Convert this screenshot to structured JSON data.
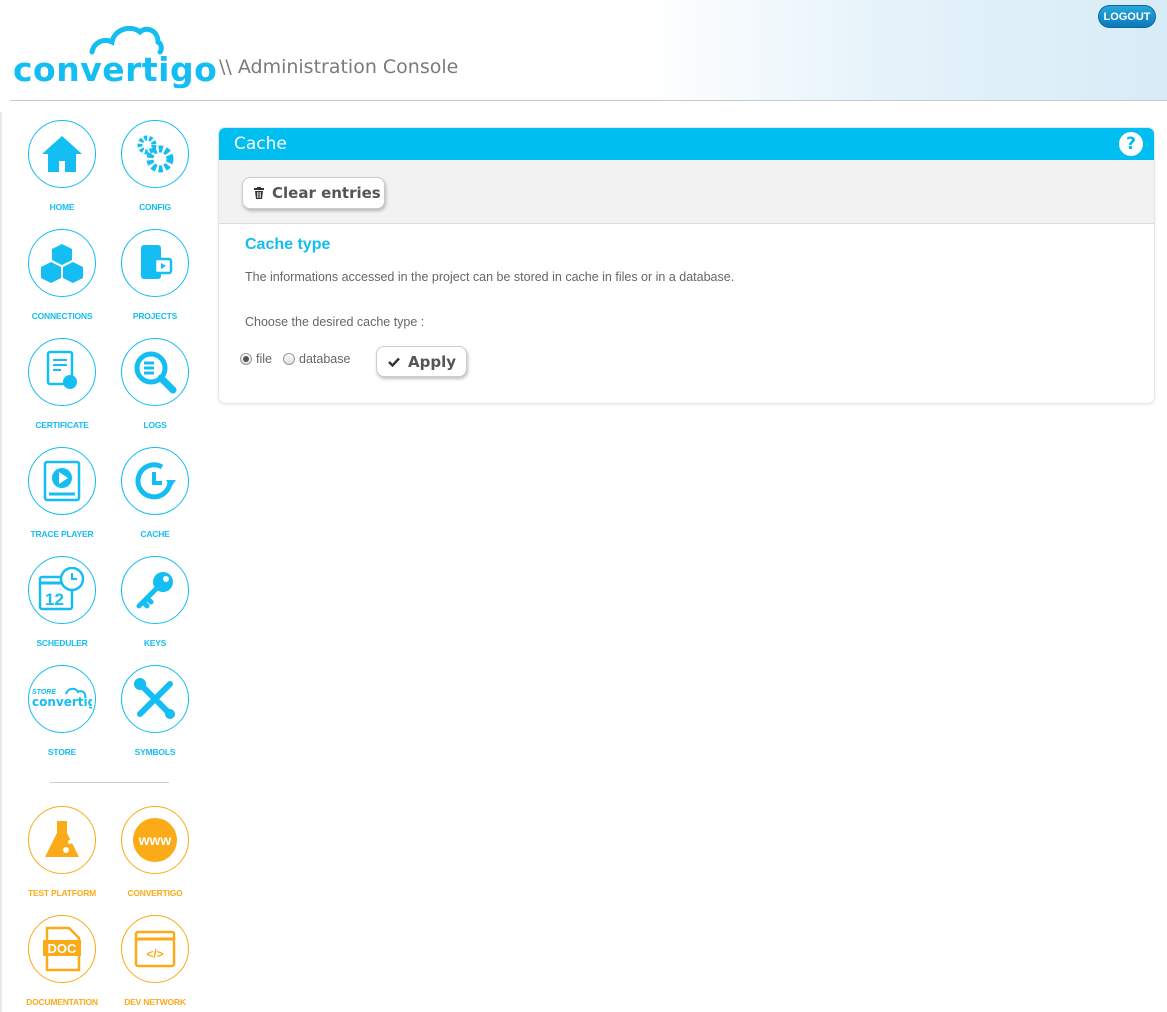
{
  "header": {
    "logo_text": "convertigo",
    "title": "\\\\ Administration Console",
    "logout": "LOGOUT"
  },
  "sidebar": {
    "items": [
      {
        "label": "HOME",
        "icon": "home-icon"
      },
      {
        "label": "CONFIG",
        "icon": "gears-icon"
      },
      {
        "label": "CONNECTIONS",
        "icon": "cubes-icon"
      },
      {
        "label": "PROJECTS",
        "icon": "projects-icon"
      },
      {
        "label": "CERTIFICATE",
        "icon": "certificate-icon"
      },
      {
        "label": "LOGS",
        "icon": "logs-search-icon"
      },
      {
        "label": "TRACE PLAYER",
        "icon": "play-icon"
      },
      {
        "label": "CACHE",
        "icon": "clock-refresh-icon"
      },
      {
        "label": "SCHEDULER",
        "icon": "calendar-icon"
      },
      {
        "label": "KEYS",
        "icon": "key-icon"
      },
      {
        "label": "STORE",
        "icon": "store-icon"
      },
      {
        "label": "SYMBOLS",
        "icon": "tools-icon"
      }
    ],
    "store_logo_text": "STORE convertigo",
    "external": [
      {
        "label": "TEST PLATFORM",
        "icon": "flask-icon"
      },
      {
        "label": "CONVERTIGO",
        "icon": "www-icon",
        "icon_text": "www"
      },
      {
        "label": "DOCUMENTATION",
        "icon": "doc-icon",
        "icon_text": "DOC"
      },
      {
        "label": "DEV NETWORK",
        "icon": "code-window-icon",
        "icon_text": "</>"
      }
    ]
  },
  "panel": {
    "title": "Cache",
    "help": "?",
    "clear_button": "Clear entries",
    "section_title": "Cache type",
    "description": "The informations accessed in the project can be stored in cache in files or in a database.",
    "choose_label": "Choose the desired cache type :",
    "options": [
      {
        "label": "file",
        "selected": true
      },
      {
        "label": "database",
        "selected": false
      }
    ],
    "apply_button": "Apply"
  },
  "colors": {
    "accent": "#00bef0",
    "orange": "#fbaa18"
  }
}
